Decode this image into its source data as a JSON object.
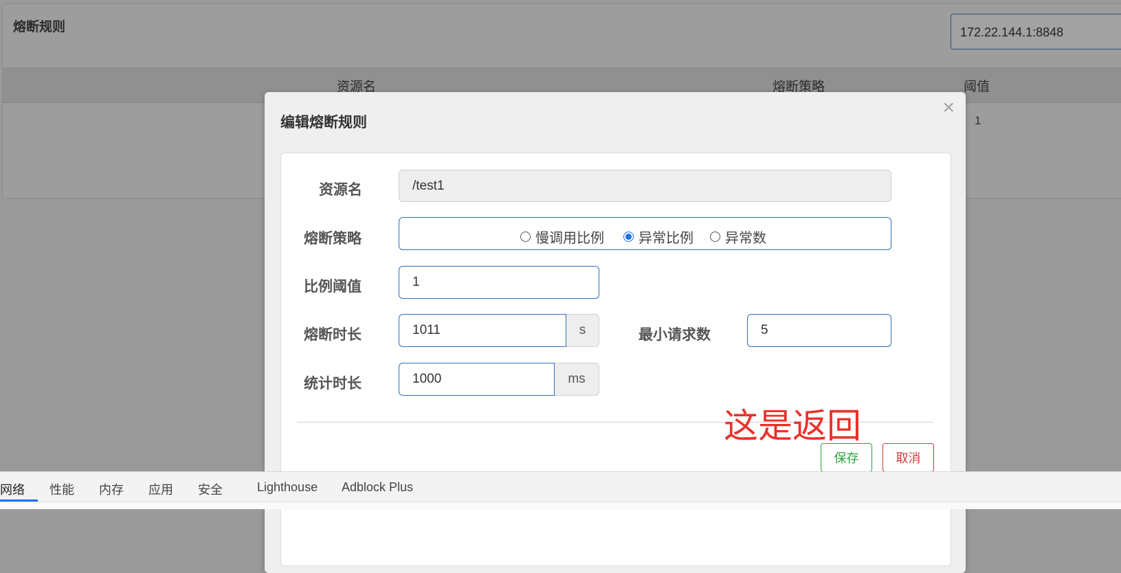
{
  "background": {
    "title": "熔断规则",
    "ip_value": "172.22.144.1:8848",
    "columns": [
      "资源名",
      "熔断策略",
      "阈值"
    ],
    "row_threshold": "1"
  },
  "modal": {
    "title": "编辑熔断规则",
    "close_glyph": "×",
    "resource": {
      "label": "资源名",
      "value": "/test1"
    },
    "strategy": {
      "label": "熔断策略",
      "options": [
        "慢调用比例",
        "异常比例",
        "异常数"
      ],
      "selected": "异常比例"
    },
    "ratio": {
      "label": "比例阈值",
      "value": "1"
    },
    "duration": {
      "label": "熔断时长",
      "value": "1011",
      "unit": "s"
    },
    "min_requests": {
      "label": "最小请求数",
      "value": "5"
    },
    "stat_duration": {
      "label": "统计时长",
      "value": "1000",
      "unit": "ms"
    },
    "annotation": "这是返回",
    "save_label": "保存",
    "cancel_label": "取消"
  },
  "devtools": {
    "tabs": [
      "网络",
      "性能",
      "内存",
      "应用",
      "安全",
      "Lighthouse",
      "Adblock Plus"
    ],
    "active_tab": "网络"
  },
  "colors": {
    "accent": "#1a73e8",
    "save": "#2e9e3c",
    "cancel": "#d43a3a",
    "annotation": "#e8322b"
  }
}
